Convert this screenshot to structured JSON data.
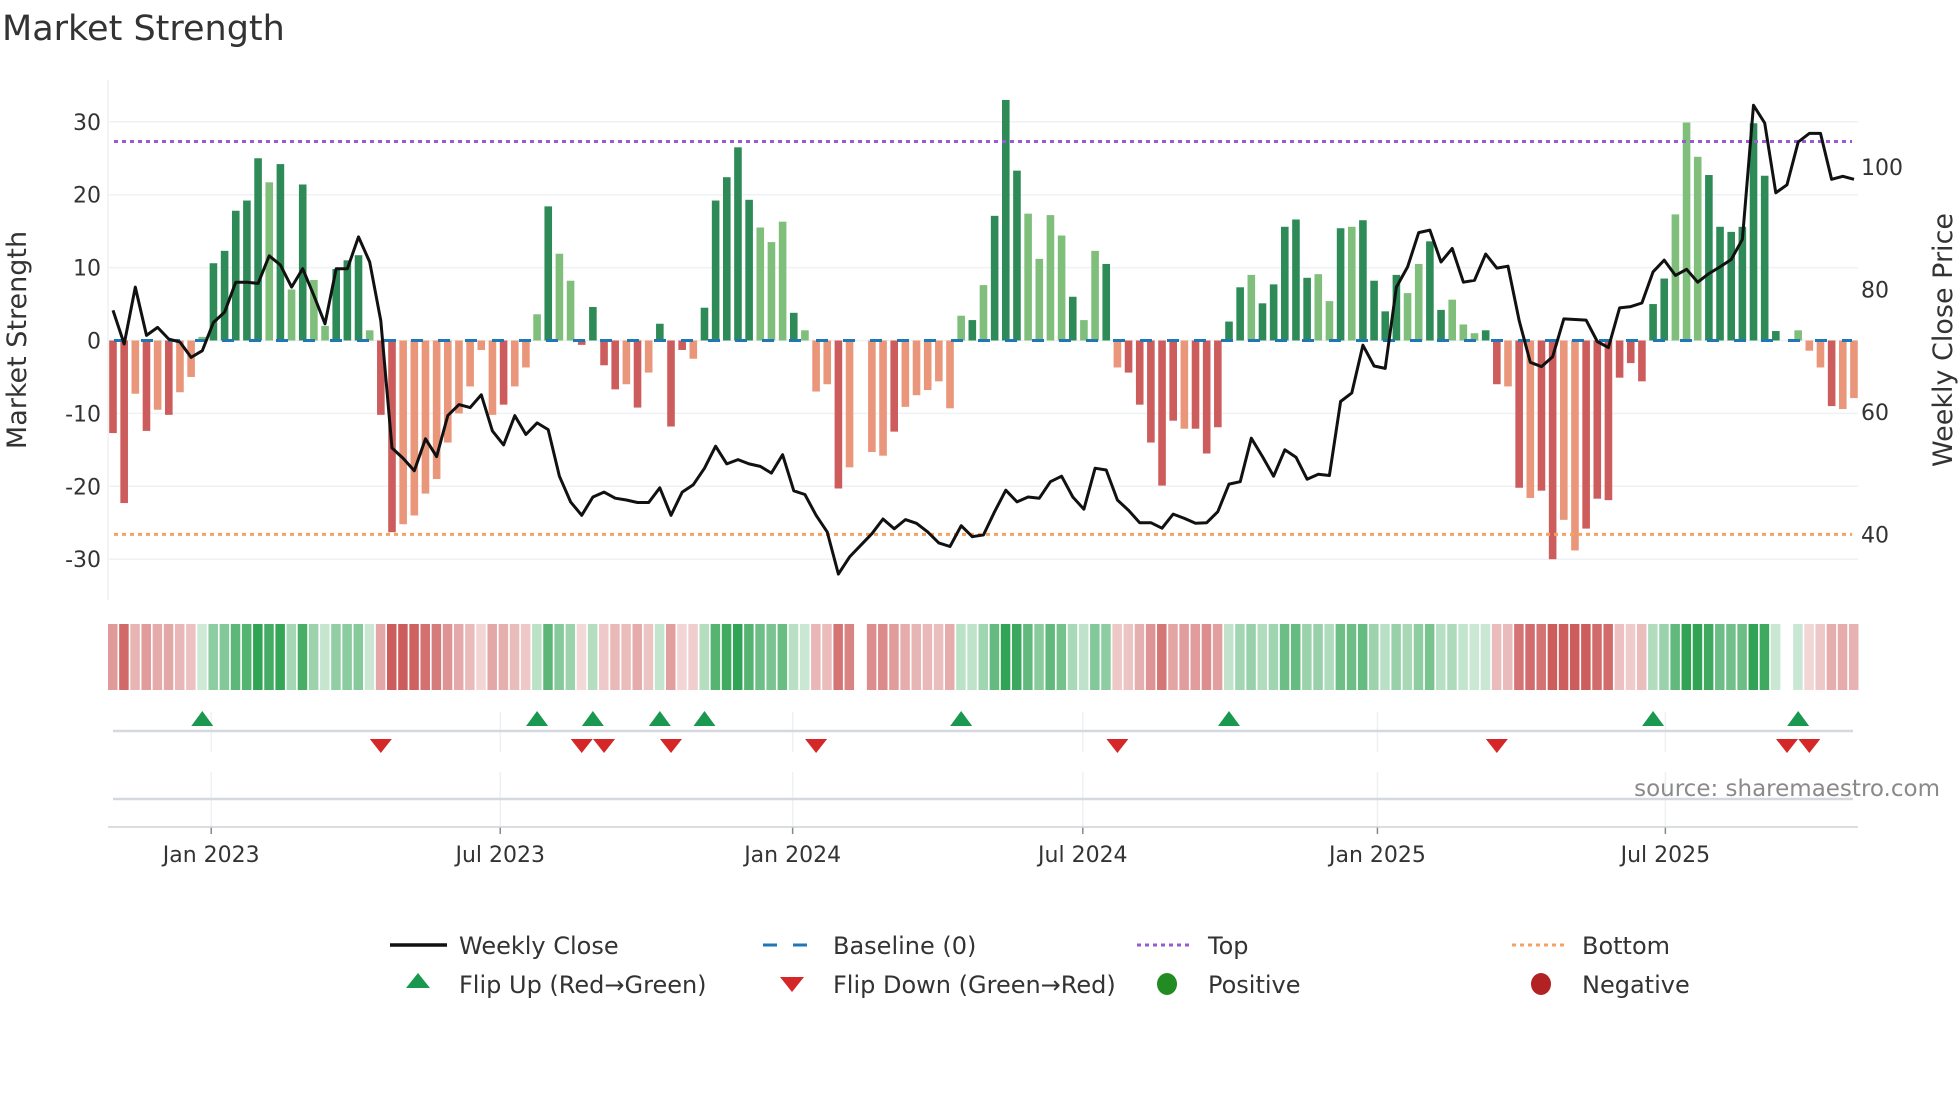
{
  "chart_data": {
    "type": "bar",
    "title": "Market Strength",
    "ylabel": "Market Strength",
    "y2label": "Weekly Close Price",
    "ylim": [
      -33,
      35
    ],
    "y2ticks": [
      40,
      60,
      80,
      100
    ],
    "yticks": [
      -30,
      -20,
      -10,
      0,
      10,
      20,
      30
    ],
    "x_unit": "week index",
    "xticks": [
      {
        "label": "Jan 2023",
        "week": 8.8
      },
      {
        "label": "Jul 2023",
        "week": 34.7
      },
      {
        "label": "Jan 2024",
        "week": 60.9
      },
      {
        "label": "Jul 2024",
        "week": 86.9
      },
      {
        "label": "Jan 2025",
        "week": 113.3
      },
      {
        "label": "Jul 2025",
        "week": 139.1
      }
    ],
    "reference_lines": {
      "baseline": 0,
      "top": 27.3,
      "bottom": -26.6
    },
    "strength": [
      -12.7,
      -22.3,
      -7.3,
      -12.4,
      -9.5,
      -10.2,
      -7.1,
      -5,
      0.5,
      10.6,
      12.3,
      17.8,
      19.2,
      25,
      21.7,
      24.2,
      7,
      21.4,
      8.3,
      2,
      9.8,
      11,
      11.7,
      1.4,
      -10.2,
      -26.3,
      -25.2,
      -24,
      -21,
      -19,
      -14,
      -10,
      -6.3,
      -1.3,
      -10.2,
      -8.8,
      -6.3,
      -3.7,
      3.6,
      18.4,
      11.9,
      8.2,
      -0.6,
      4.6,
      -3.4,
      -6.7,
      -6,
      -9.2,
      -4.4,
      2.3,
      -11.8,
      -1.3,
      -2.5,
      4.5,
      19.2,
      22.4,
      26.5,
      19.3,
      15.5,
      13.5,
      16.3,
      3.8,
      1.4,
      -7,
      -6,
      -20.3,
      -17.4,
      0,
      -15.3,
      -15.8,
      -12.5,
      -9.1,
      -7.5,
      -6.8,
      -5.6,
      -9.3,
      3.4,
      2.8,
      7.6,
      17.1,
      33,
      23.3,
      17.4,
      11.2,
      17.2,
      14.4,
      6,
      2.8,
      12.3,
      10.5,
      -3.7,
      -4.4,
      -8.8,
      -14,
      -19.9,
      -11,
      -12.1,
      -12.1,
      -15.5,
      -11.9,
      2.6,
      7.3,
      9,
      5.1,
      7.7,
      15.6,
      16.6,
      8.6,
      9.1,
      5.4,
      15.4,
      15.6,
      16.5,
      8.2,
      4,
      9,
      6.5,
      10.5,
      13.6,
      4.2,
      5.6,
      2.2,
      1,
      1.4,
      -6,
      -6.3,
      -20.2,
      -21.6,
      -20.6,
      -30,
      -24.6,
      -28.8,
      -25.8,
      -21.7,
      -21.9,
      -5.1,
      -3.1,
      -5.6,
      5,
      8.5,
      17.3,
      29.9,
      25.2,
      22.7,
      15.6,
      14.9,
      15.6,
      29.8,
      22.6,
      1.3,
      0,
      1.4,
      -1.4,
      -3.7,
      -9,
      -9.4,
      -7.9
    ],
    "strong": "ddldldllldddddldldlldddlddllllllllldllldllddddldldddldddddllldllldlllldlllllldldddlllldlldldddddldddddldddddlldlddddllddlllddldlddllddddddddllldddddddlllldlldddddd",
    "weekly_close": [
      76.6,
      71.1,
      80.4,
      72.5,
      73.8,
      71.9,
      71.4,
      68.9,
      70.0,
      74.6,
      76.3,
      81.2,
      81.2,
      81.0,
      85.5,
      84.0,
      80.4,
      83.4,
      79.0,
      74.4,
      83.4,
      83.4,
      88.6,
      84.5,
      74.9,
      54.1,
      52.4,
      50.4,
      55.6,
      52.7,
      59.4,
      61.2,
      60.7,
      62.8,
      56.9,
      54.6,
      59.4,
      56.3,
      58.2,
      57.1,
      49.5,
      45.3,
      43.1,
      46.1,
      46.9,
      45.9,
      45.6,
      45.2,
      45.2,
      47.6,
      43.1,
      46.9,
      48.1,
      50.8,
      54.4,
      51.5,
      52.2,
      51.5,
      51.1,
      50.0,
      53.0,
      47.1,
      46.5,
      43.1,
      40.4,
      33.5,
      36.3,
      38.2,
      40.1,
      42.5,
      40.9,
      42.4,
      41.8,
      40.4,
      38.6,
      38.0,
      41.4,
      39.6,
      39.9,
      43.7,
      47.2,
      45.3,
      46.1,
      45.9,
      48.6,
      49.5,
      46.1,
      44.1,
      50.8,
      50.5,
      45.6,
      43.9,
      41.9,
      41.9,
      41.0,
      43.3,
      42.6,
      41.8,
      41.9,
      43.7,
      48.2,
      48.6,
      55.7,
      52.7,
      49.5,
      53.8,
      52.6,
      49.0,
      49.8,
      49.6,
      61.7,
      63.1,
      70.9,
      67.5,
      67.1,
      80.4,
      83.7,
      89.3,
      89.7,
      84.5,
      86.7,
      81.2,
      81.5,
      85.8,
      83.5,
      83.8,
      74.9,
      68.1,
      67.4,
      69.0,
      75.2,
      75.1,
      75.0,
      71.5,
      70.5,
      77.0,
      77.2,
      77.8,
      82.9,
      84.8,
      82.3,
      83.3,
      81.2,
      82.6,
      83.7,
      84.9,
      88.2,
      110.1,
      107.2,
      95.8,
      97.1,
      104.1,
      105.5,
      105.5,
      98.0,
      98.5,
      98.0
    ],
    "flip_up_weeks": [
      8,
      38,
      43,
      49,
      53,
      76,
      100,
      138,
      151
    ],
    "flip_down_weeks": [
      24,
      42,
      44,
      50,
      63,
      90,
      124,
      150,
      152
    ],
    "legend_placement": "bottom-center"
  },
  "legend": {
    "weekly_close": "Weekly Close",
    "baseline": "Baseline (0)",
    "top": "Top",
    "bottom": "Bottom",
    "flip_up": "Flip Up (Red→Green)",
    "flip_down": "Flip Down (Green→Red)",
    "positive": "Positive",
    "negative": "Negative"
  },
  "source": "source: sharemaestro.com",
  "colors": {
    "strong_pos": "#2e8b57",
    "weak_pos": "#7fbf7b",
    "strong_neg": "#cd5c5c",
    "weak_neg": "#e9967a",
    "line": "#111111",
    "baseline": "#1f77b4",
    "top": "#9b59d6",
    "bottom": "#f4a261",
    "flip_up": "#1a9850",
    "flip_down": "#d62728",
    "positive": "#228b22",
    "negative": "#b22222"
  }
}
